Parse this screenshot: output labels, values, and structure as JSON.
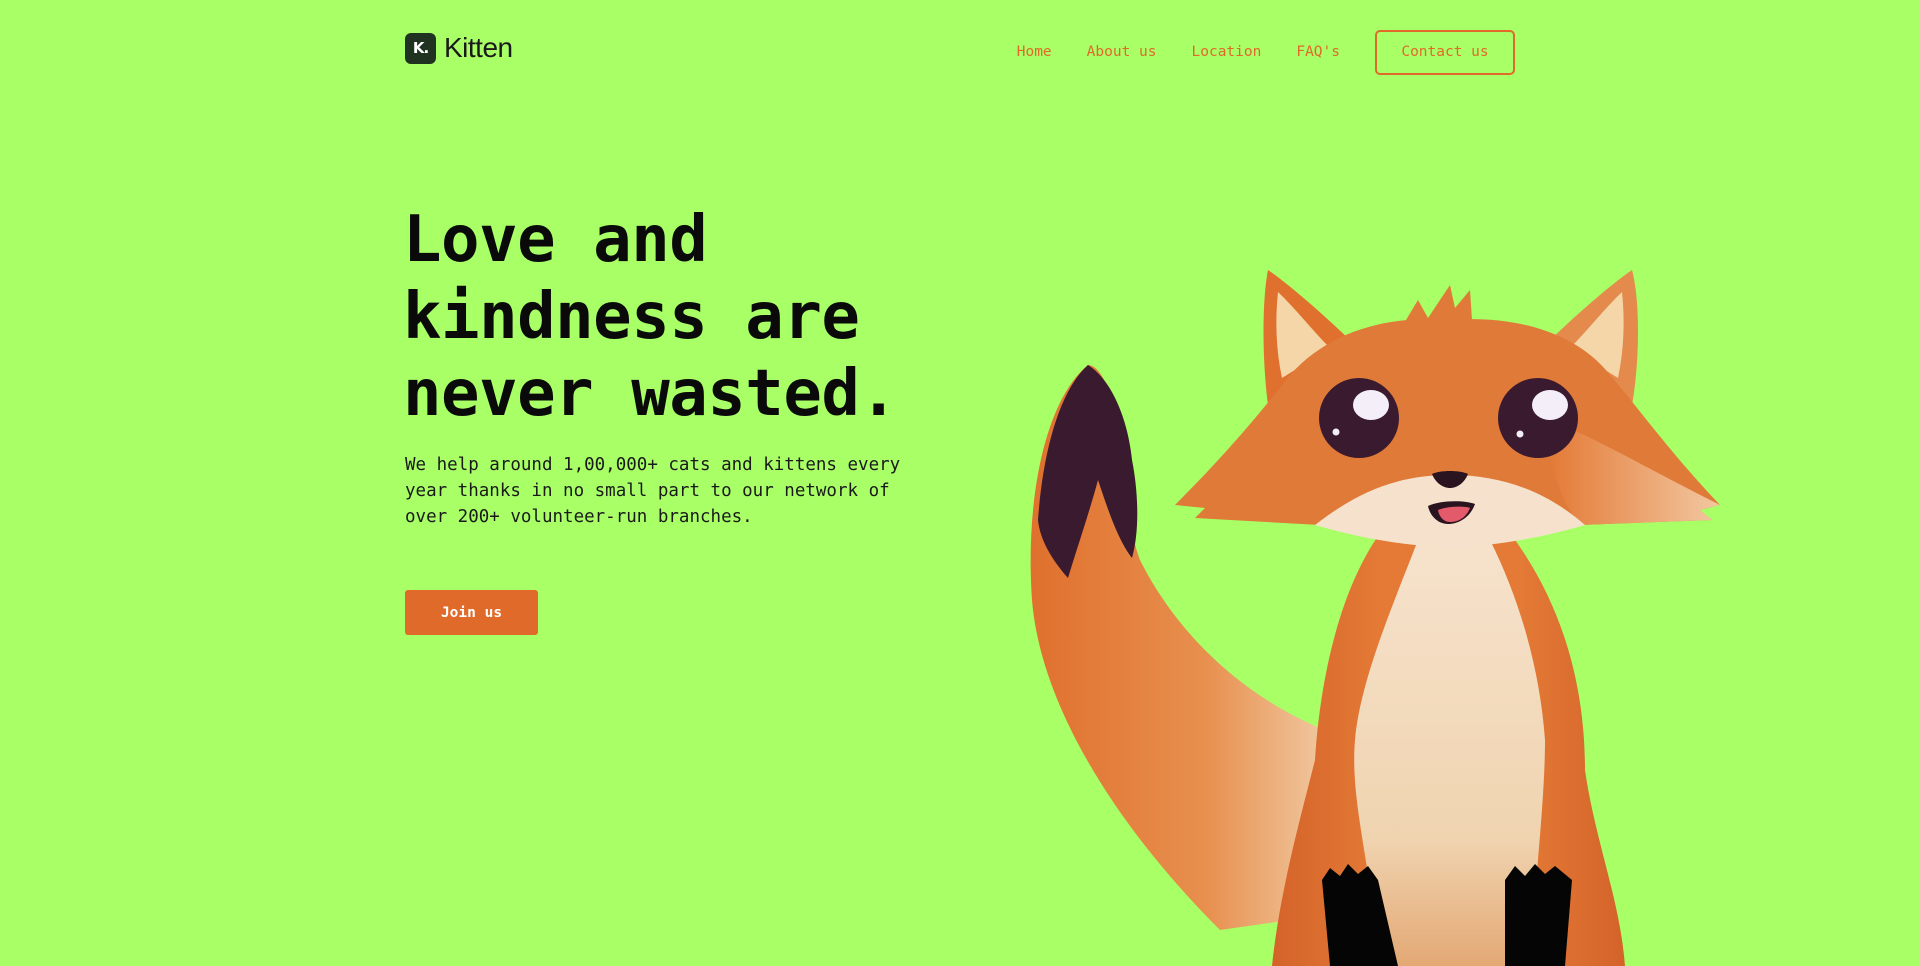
{
  "brand": {
    "logo_mark": "K.",
    "name": "Kitten"
  },
  "nav": {
    "links": [
      "Home",
      "About us",
      "Location",
      "FAQ's"
    ],
    "contact_label": "Contact us"
  },
  "hero": {
    "title_lines": [
      "Love and",
      "kindness are",
      "never wasted."
    ],
    "description_lines": [
      "We help around 1,00,000+ cats and kittens every",
      "year thanks in no small part to our network of",
      "over 200+ volunteer-run branches."
    ],
    "cta_label": "Join us"
  },
  "illustration": {
    "subject": "fox-illustration"
  },
  "colors": {
    "background": "#a8ff66",
    "accent": "#e06a2a",
    "text": "#0a0a0a",
    "logo_bg": "#1f3320"
  }
}
